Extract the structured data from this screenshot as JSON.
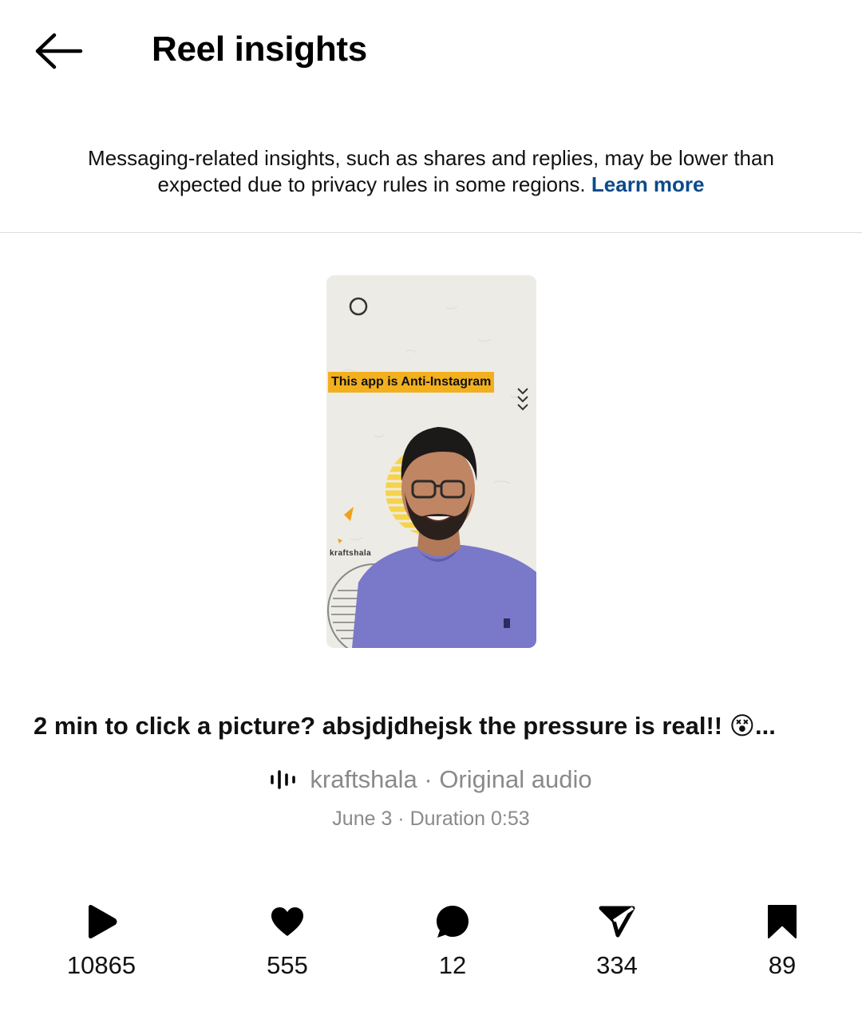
{
  "header": {
    "title": "Reel insights",
    "back_icon": "arrow-left-icon"
  },
  "notice": {
    "text": "Messaging-related insights, such as shares and replies, may be lower than expected due to privacy rules in some regions.",
    "link": "Learn more",
    "link_color": "#0b4a8b"
  },
  "thumbnail": {
    "banner_text": "This app is Anti-Instagram",
    "brand_text": "kraftshala",
    "banner_color": "#f2b01e"
  },
  "reel": {
    "caption": "2 min to click a picture? absjdjdhejsk the pressure is real!! 😵...",
    "audio": "kraftshala · Original audio",
    "audio_icon": "audio-waveform-icon",
    "meta": "June 3 · Duration 0:53"
  },
  "stats": {
    "plays": {
      "icon": "play-icon",
      "value": "10865"
    },
    "likes": {
      "icon": "heart-icon",
      "value": "555"
    },
    "comments": {
      "icon": "comment-icon",
      "value": "12"
    },
    "shares": {
      "icon": "share-icon",
      "value": "334"
    },
    "saves": {
      "icon": "bookmark-icon",
      "value": "89"
    }
  }
}
